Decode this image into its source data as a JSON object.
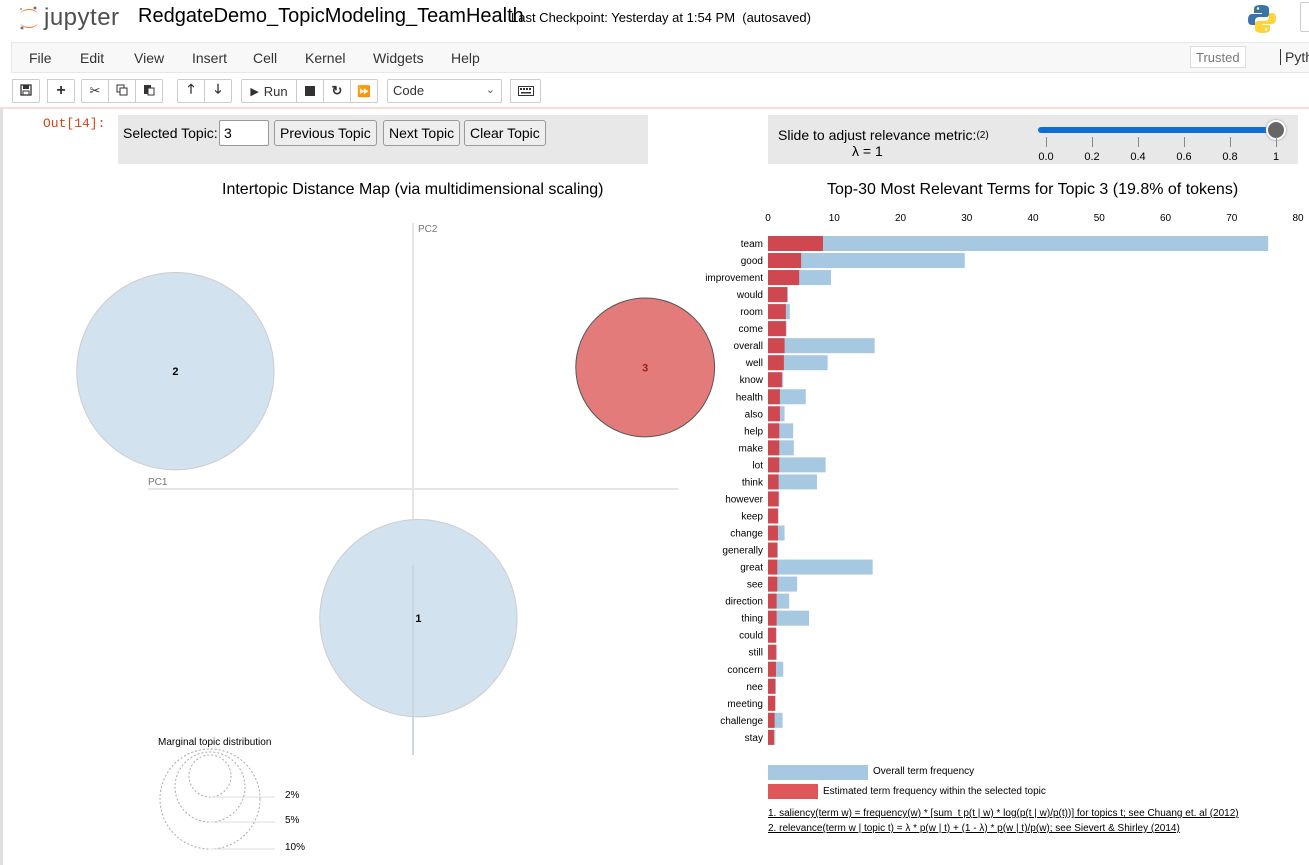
{
  "header": {
    "logo_text": "jupyter",
    "notebook_name": "RedgateDemo_TopicModeling_TeamHealth",
    "checkpoint": "Last Checkpoint: Yesterday at 1:54 PM  (autosaved)"
  },
  "menubar": {
    "items": [
      "File",
      "Edit",
      "View",
      "Insert",
      "Cell",
      "Kernel",
      "Widgets",
      "Help"
    ],
    "trusted": "Trusted",
    "kernel": "Pyth"
  },
  "toolbar": {
    "run_label": "Run",
    "cell_type": "Code",
    "icons": [
      "save-icon",
      "plus-icon",
      "cut-icon",
      "copy-icon",
      "paste-icon",
      "arrow-up-icon",
      "arrow-down-icon",
      "run-icon",
      "stop-icon",
      "restart-icon",
      "fast-forward-icon",
      "keyboard-icon"
    ]
  },
  "cell": {
    "out_prompt": "Out[14]:"
  },
  "topic_controls": {
    "label": "Selected Topic:",
    "value": "3",
    "previous": "Previous Topic",
    "next": "Next Topic",
    "clear": "Clear Topic"
  },
  "relevance": {
    "label": "Slide to adjust relevance metric:",
    "footnote_ref": "(2)",
    "lambda_text": "λ = 1",
    "lambda_value": 1,
    "ticks": [
      "0.0",
      "0.2",
      "0.4",
      "0.6",
      "0.8",
      "1"
    ]
  },
  "colors": {
    "overall_bar": "#a6c8e0",
    "topic_bar": "#d0484f",
    "bubble_default": "#d2e3ef",
    "bubble_selected": "#e37b7b",
    "slider": "#0f6cd1"
  },
  "chart_data": [
    {
      "type": "scatter",
      "title": "Intertopic Distance Map (via multidimensional scaling)",
      "xlabel": "PC1",
      "ylabel": "PC2",
      "points": [
        {
          "topic": "1",
          "x": 0.01,
          "y": -0.34,
          "size_pct": 40,
          "selected": false
        },
        {
          "topic": "2",
          "x": -0.44,
          "y": 0.31,
          "size_pct": 40,
          "selected": false
        },
        {
          "topic": "3",
          "x": 0.43,
          "y": 0.32,
          "size_pct": 19.8,
          "selected": true
        }
      ],
      "legend": {
        "title": "Marginal topic distribution",
        "entries": [
          "2%",
          "5%",
          "10%"
        ]
      }
    },
    {
      "type": "bar",
      "orientation": "horizontal",
      "title": "Top-30 Most Relevant Terms for Topic 3 (19.8% of tokens)",
      "xlim": [
        0,
        80
      ],
      "xticks": [
        0,
        10,
        20,
        30,
        40,
        50,
        60,
        70,
        80
      ],
      "categories": [
        "team",
        "good",
        "improvement",
        "would",
        "room",
        "come",
        "overall",
        "well",
        "know",
        "health",
        "also",
        "help",
        "make",
        "lot",
        "think",
        "however",
        "keep",
        "change",
        "generally",
        "great",
        "see",
        "direction",
        "thing",
        "could",
        "still",
        "concern",
        "nee",
        "meeting",
        "challenge",
        "stay"
      ],
      "series": [
        {
          "name": "Overall term frequency",
          "values": [
            75.5,
            29.7,
            9.5,
            3.0,
            3.3,
            2.8,
            16.1,
            9.0,
            2.3,
            5.7,
            2.5,
            3.8,
            3.9,
            8.7,
            7.4,
            1.7,
            1.6,
            2.5,
            1.5,
            15.8,
            4.4,
            3.2,
            6.2,
            1.3,
            1.4,
            2.3,
            1.2,
            1.1,
            2.2,
            1.1
          ]
        },
        {
          "name": "Estimated term frequency within the selected topic",
          "values": [
            8.3,
            5.0,
            4.7,
            2.9,
            2.7,
            2.7,
            2.5,
            2.4,
            2.1,
            1.8,
            1.8,
            1.7,
            1.7,
            1.7,
            1.6,
            1.6,
            1.5,
            1.5,
            1.4,
            1.4,
            1.4,
            1.3,
            1.3,
            1.2,
            1.2,
            1.2,
            1.1,
            1.1,
            1.0,
            0.9
          ]
        }
      ],
      "legend": [
        "Overall term frequency",
        "Estimated term frequency within the selected topic"
      ],
      "footnotes": [
        "1. saliency(term w) = frequency(w) * [sum_t p(t | w) * log(p(t | w)/p(t))] for topics t; see Chuang et. al (2012)",
        "2. relevance(term w | topic t) = λ * p(w | t) + (1 - λ) * p(w | t)/p(w); see Sievert & Shirley (2014)"
      ]
    }
  ]
}
